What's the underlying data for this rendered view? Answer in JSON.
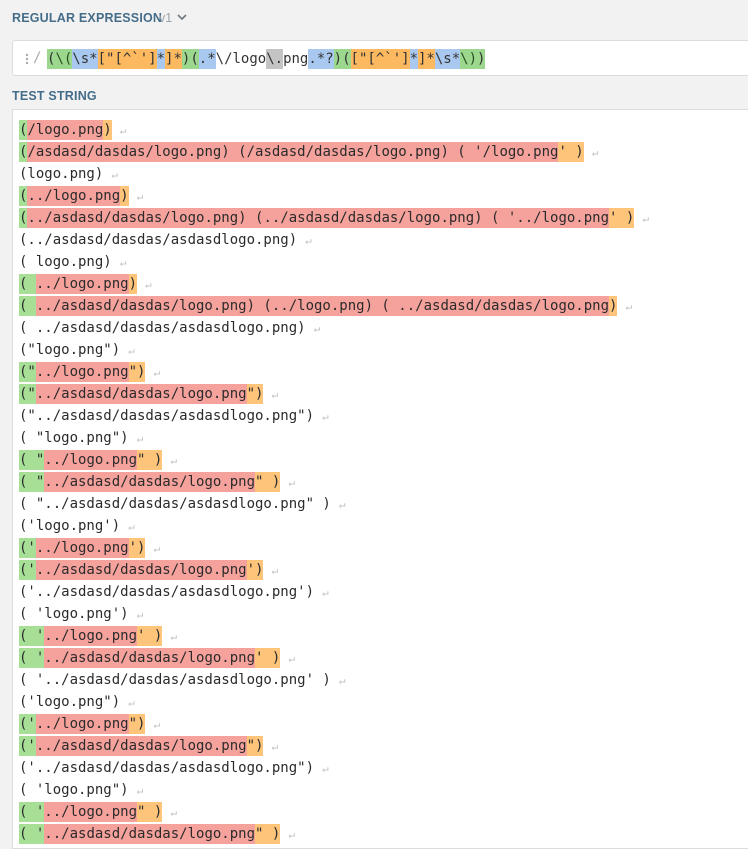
{
  "header": {
    "title": "REGULAR EXPRESSION",
    "version": "v1",
    "chevron_icon": "chevron-down-icon"
  },
  "regex": {
    "delimiter_open": "/",
    "parts": [
      {
        "text": "(",
        "type": "group"
      },
      {
        "text": "\\(",
        "type": "groupesc"
      },
      {
        "text": "\\s*",
        "type": "blue"
      },
      {
        "text": "[\"[^`']",
        "type": "cls"
      },
      {
        "text": "*",
        "type": "blue"
      },
      {
        "text": "]*",
        "type": "cls"
      },
      {
        "text": ")",
        "type": "group"
      },
      {
        "text": "(",
        "type": "group"
      },
      {
        "text": ".*",
        "type": "blue"
      },
      {
        "text": "\\/logo",
        "type": "plain"
      },
      {
        "text": "\\.",
        "type": "gray"
      },
      {
        "text": "png",
        "type": "plain"
      },
      {
        "text": ".*?",
        "type": "blue"
      },
      {
        "text": ")",
        "type": "group"
      },
      {
        "text": "(",
        "type": "group"
      },
      {
        "text": "[\"[^`']",
        "type": "cls"
      },
      {
        "text": "*",
        "type": "blue"
      },
      {
        "text": "]*",
        "type": "cls"
      },
      {
        "text": "\\s*",
        "type": "blue"
      },
      {
        "text": "\\)",
        "type": "groupesc"
      },
      {
        "text": ")",
        "type": "group"
      }
    ]
  },
  "test_string": {
    "title": "TEST STRING",
    "lines": [
      {
        "segs": [
          [
            "g",
            "("
          ],
          [
            "r",
            "/logo.png"
          ],
          [
            "o",
            ")"
          ]
        ]
      },
      {
        "segs": [
          [
            "g",
            "("
          ],
          [
            "r",
            "/asdasd/dasdas/logo.png) (/asdasd/dasdas/logo.png) ( '/logo.png"
          ],
          [
            "o",
            "' )"
          ]
        ]
      },
      {
        "segs": [
          [
            "",
            "(logo.png)"
          ]
        ]
      },
      {
        "segs": [
          [
            "g",
            "("
          ],
          [
            "r",
            "../logo.png"
          ],
          [
            "o",
            ")"
          ]
        ]
      },
      {
        "segs": [
          [
            "g",
            "("
          ],
          [
            "r",
            "../asdasd/dasdas/logo.png) (../asdasd/dasdas/logo.png) ( '../logo.png"
          ],
          [
            "o",
            "' )"
          ]
        ]
      },
      {
        "segs": [
          [
            "",
            "(../asdasd/dasdas/asdasdlogo.png)"
          ]
        ]
      },
      {
        "segs": [
          [
            "",
            "( logo.png)"
          ]
        ]
      },
      {
        "segs": [
          [
            "g",
            "( "
          ],
          [
            "r",
            "../logo.png"
          ],
          [
            "o",
            ")"
          ]
        ]
      },
      {
        "segs": [
          [
            "g",
            "( "
          ],
          [
            "r",
            "../asdasd/dasdas/logo.png) (../logo.png) ( ../asdasd/dasdas/logo.png"
          ],
          [
            "o",
            ")"
          ]
        ]
      },
      {
        "segs": [
          [
            "",
            "( ../asdasd/dasdas/asdasdlogo.png)"
          ]
        ]
      },
      {
        "segs": [
          [
            "",
            "(\"logo.png\")"
          ]
        ]
      },
      {
        "segs": [
          [
            "g",
            "(\""
          ],
          [
            "r",
            "../logo.png"
          ],
          [
            "o",
            "\")"
          ]
        ]
      },
      {
        "segs": [
          [
            "g",
            "(\""
          ],
          [
            "r",
            "../asdasd/dasdas/logo.png"
          ],
          [
            "o",
            "\")"
          ]
        ]
      },
      {
        "segs": [
          [
            "",
            "(\"../asdasd/dasdas/asdasdlogo.png\")"
          ]
        ]
      },
      {
        "segs": [
          [
            "",
            "( \"logo.png\")"
          ]
        ]
      },
      {
        "segs": [
          [
            "g",
            "( \""
          ],
          [
            "r",
            "../logo.png"
          ],
          [
            "o",
            "\" )"
          ]
        ]
      },
      {
        "segs": [
          [
            "g",
            "( \""
          ],
          [
            "r",
            "../asdasd/dasdas/logo.png"
          ],
          [
            "o",
            "\" )"
          ]
        ]
      },
      {
        "segs": [
          [
            "",
            "( \"../asdasd/dasdas/asdasdlogo.png\" )"
          ]
        ]
      },
      {
        "segs": [
          [
            "",
            "('logo.png')"
          ]
        ]
      },
      {
        "segs": [
          [
            "g",
            "('"
          ],
          [
            "r",
            "../logo.png"
          ],
          [
            "o",
            "')"
          ]
        ]
      },
      {
        "segs": [
          [
            "g",
            "('"
          ],
          [
            "r",
            "../asdasd/dasdas/logo.png"
          ],
          [
            "o",
            "')"
          ]
        ]
      },
      {
        "segs": [
          [
            "",
            "('../asdasd/dasdas/asdasdlogo.png')"
          ]
        ]
      },
      {
        "segs": [
          [
            "",
            "( 'logo.png')"
          ]
        ]
      },
      {
        "segs": [
          [
            "g",
            "( '"
          ],
          [
            "r",
            "../logo.png"
          ],
          [
            "o",
            "' )"
          ]
        ]
      },
      {
        "segs": [
          [
            "g",
            "( '"
          ],
          [
            "r",
            "../asdasd/dasdas/logo.png"
          ],
          [
            "o",
            "' )"
          ]
        ]
      },
      {
        "segs": [
          [
            "",
            "( '../asdasd/dasdas/asdasdlogo.png' )"
          ]
        ]
      },
      {
        "segs": [
          [
            "",
            "('logo.png\")"
          ]
        ]
      },
      {
        "segs": [
          [
            "g",
            "('"
          ],
          [
            "r",
            "../logo.png"
          ],
          [
            "o",
            "\")"
          ]
        ]
      },
      {
        "segs": [
          [
            "g",
            "('"
          ],
          [
            "r",
            "../asdasd/dasdas/logo.png"
          ],
          [
            "o",
            "\")"
          ]
        ]
      },
      {
        "segs": [
          [
            "",
            "('../asdasd/dasdas/asdasdlogo.png\")"
          ]
        ]
      },
      {
        "segs": [
          [
            "",
            "( 'logo.png\")"
          ]
        ]
      },
      {
        "segs": [
          [
            "g",
            "( '"
          ],
          [
            "r",
            "../logo.png"
          ],
          [
            "o",
            "\" )"
          ]
        ]
      },
      {
        "segs": [
          [
            "g",
            "( '"
          ],
          [
            "r",
            "../asdasd/dasdas/logo.png"
          ],
          [
            "o",
            "\" )"
          ]
        ]
      }
    ]
  },
  "colors": {
    "group": "#a7df97",
    "match": "#f6a29c",
    "trail": "#fdc47a",
    "quantifier": "#a9c8ef",
    "label": "#456d8a"
  }
}
